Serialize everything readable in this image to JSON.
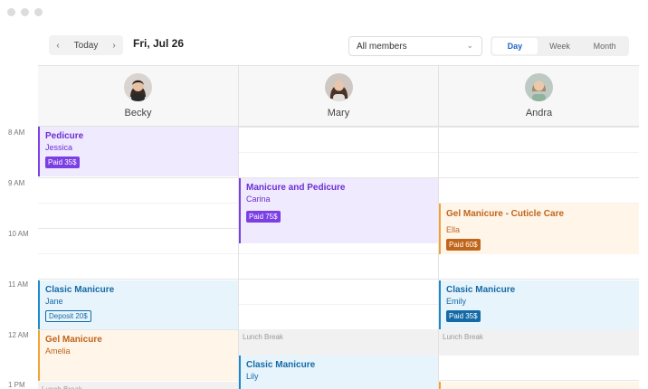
{
  "header": {
    "prev_icon": "chevron-left-icon",
    "prev_glyph": "‹",
    "today_label": "Today",
    "next_icon": "chevron-right-icon",
    "next_glyph": "›",
    "date_title": "Fri, Jul 26",
    "member_select": {
      "value": "All members",
      "chevron": "⌄"
    },
    "views": [
      {
        "label": "Day",
        "active": true
      },
      {
        "label": "Week",
        "active": false
      },
      {
        "label": "Month",
        "active": false
      }
    ]
  },
  "staff": [
    {
      "name": "Becky"
    },
    {
      "name": "Mary"
    },
    {
      "name": "Andra"
    }
  ],
  "time_labels": [
    "8 AM",
    "9 AM",
    "10 AM",
    "11 AM",
    "12 AM",
    "1 PM"
  ],
  "events": [
    {
      "title": "Pedicure",
      "client": "Jessica",
      "badge": "Paid 35$",
      "color": "purple"
    },
    {
      "title": "Manicure and Pedicure",
      "client": "Carina",
      "badge": "Paid 75$",
      "color": "purple"
    },
    {
      "title": "Gel Manicure - Cuticle Care",
      "client": "Ella",
      "badge": "Paid 60$",
      "color": "orange"
    },
    {
      "title": "Clasic Manicure",
      "client": "Jane",
      "badge": "Deposit 20$",
      "color": "blue"
    },
    {
      "title": "Clasic Manicure",
      "client": "Emily",
      "badge": "Paid 35$",
      "color": "blue"
    },
    {
      "title": "Gel Manicure",
      "client": "Amelia",
      "badge": "",
      "color": "orange"
    },
    {
      "title": "Clasic Manicure",
      "client": "Lily",
      "badge": "",
      "color": "blue"
    }
  ],
  "lunch_label": "Lunch Break",
  "colors": {
    "purple": "#7b3fe4",
    "blue": "#1a8acb",
    "orange": "#f0a236",
    "accent": "#1e63c7"
  }
}
